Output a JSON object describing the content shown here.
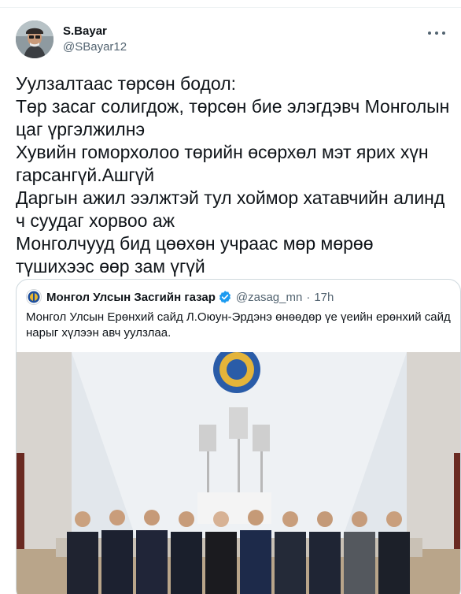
{
  "author": {
    "name": "S.Bayar",
    "handle": "@SBayar12"
  },
  "tweet": {
    "text": "Уулзалтаас төрсөн бодол:\nТөр засаг солигдож, төрсөн бие элэгдэвч Монголын цаг үргэлжилнэ\nХувийн гоморхолоо төрийн өсөрхөл мэт ярих хүн гарсангүй.Ашгүй\nДаргын ажил ээлжтэй тул хоймор хатавчийн алинд ч суудаг хорвоо аж\nМонголчууд бид цөөхөн учраас мөр мөрөө түшихээс өөр зам үгүй"
  },
  "quoted_tweet": {
    "name": "Монгол Улсын Засгийн газар",
    "handle": "@zasag_mn",
    "separator": "·",
    "time": "17h",
    "text": "Монгол Улсын Ерөнхий сайд Л.Оюун-Эрдэнэ өнөөдөр үе үеийн ерөнхий сайд нарыг хүлээн авч уулзлаа."
  },
  "colors": {
    "text_primary": "#0f1419",
    "text_secondary": "#536471",
    "border": "#cfd9de",
    "verified": "#1d9bf0"
  },
  "icons": {
    "more": "more-horizontal-icon",
    "verified": "verified-badge-icon",
    "quoted_avatar": "state-emblem-icon"
  }
}
